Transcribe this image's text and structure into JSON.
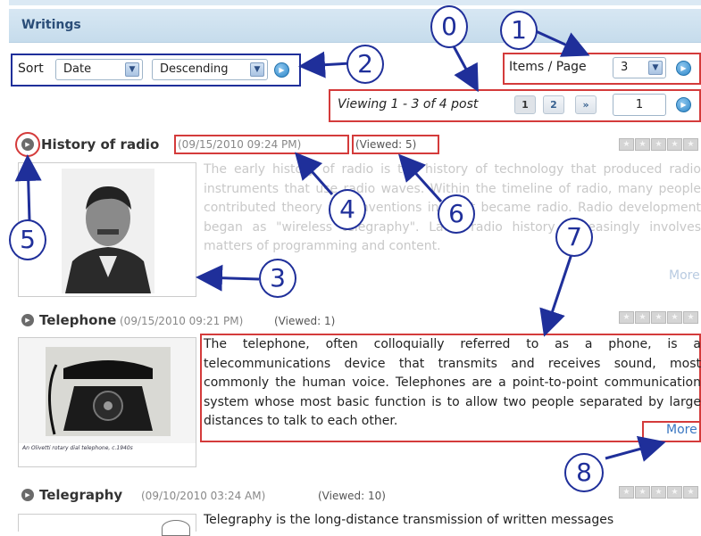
{
  "header": {
    "title": "Writings"
  },
  "sort": {
    "label": "Sort",
    "field_value": "Date",
    "order_value": "Descending"
  },
  "paging": {
    "items_per_page_label": "Items / Page",
    "items_per_page_value": "3",
    "viewing_text": "Viewing 1 - 3 of 4 post",
    "pages": [
      "1",
      "2"
    ],
    "next_label": "»",
    "page_input_value": "1"
  },
  "posts": [
    {
      "title": "History of radio",
      "date": "(09/15/2010 09:24 PM)",
      "viewed": "(Viewed: 5)",
      "body": "The early history of radio is the history of technology that produced radio instruments that use radio waves. Within the timeline of radio, many people contributed theory and inventions in what became radio. Radio development began as \"wireless telegraphy\". Later radio history increasingly involves matters of programming and content.",
      "more": "More"
    },
    {
      "title": "Telephone",
      "date": "(09/15/2010 09:21 PM)",
      "viewed": "(Viewed: 1)",
      "body": "The telephone, often colloquially referred to as a phone, is a telecommunications device that transmits and receives sound, most commonly the human voice. Telephones are a point-to-point communication system whose most basic function is to allow two people separated by large distances to talk to each other.",
      "more": "More",
      "caption": "An Olivetti rotary dial telephone, c.1940s"
    },
    {
      "title": "Telegraphy",
      "date": "(09/10/2010 03:24 AM)",
      "viewed": "(Viewed: 10)",
      "body": "Telegraphy is the long-distance transmission of written messages"
    }
  ],
  "callouts": [
    "0",
    "1",
    "2",
    "3",
    "4",
    "5",
    "6",
    "7",
    "8"
  ],
  "icons": {
    "dropdown": "chevron-down-icon",
    "go": "go-arrow-icon",
    "post_bullet": "play-bullet-icon",
    "rating": "star-rating-icon"
  },
  "colors": {
    "header_bg": "#c6dcec",
    "header_text": "#2a4d78",
    "annotation_red": "#d43b3b",
    "annotation_blue": "#1f2f9a",
    "link": "#3a77c2"
  }
}
